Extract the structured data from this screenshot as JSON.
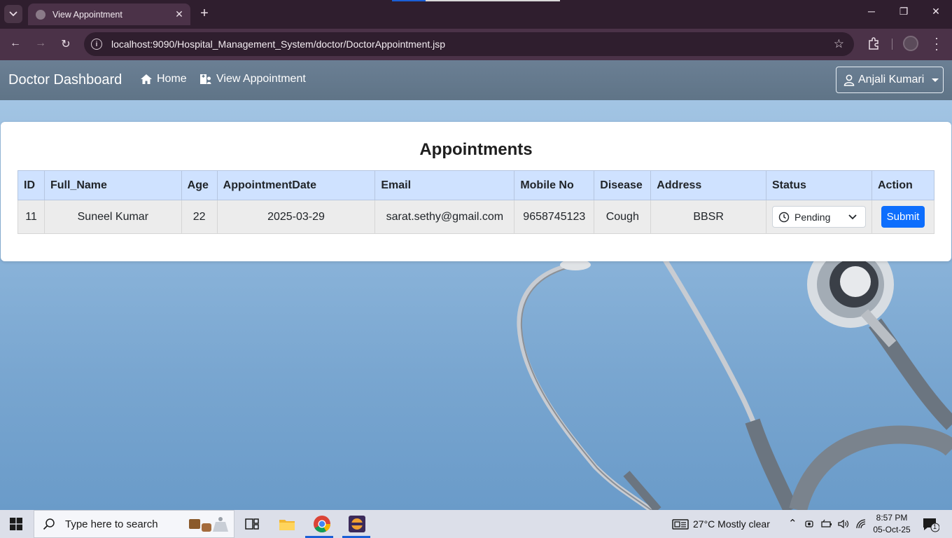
{
  "browser": {
    "tab_title": "View Appointment",
    "url": "localhost:9090/Hospital_Management_System/doctor/DoctorAppointment.jsp"
  },
  "navbar": {
    "brand": "Doctor Dashboard",
    "links": [
      {
        "label": "Home",
        "icon": "home-icon"
      },
      {
        "label": "View Appointment",
        "icon": "hospital-user-icon"
      }
    ],
    "user": {
      "label": "Anjali Kumari",
      "icon": "user-icon"
    }
  },
  "appointments": {
    "title": "Appointments",
    "columns": [
      "ID",
      "Full_Name",
      "Age",
      "AppointmentDate",
      "Email",
      "Mobile No",
      "Disease",
      "Address",
      "Status",
      "Action"
    ],
    "rows": [
      {
        "id": "11",
        "full_name": "Suneel Kumar",
        "age": "22",
        "appointment_date": "2025-03-29",
        "email": "sarat.sethy@gmail.com",
        "mobile": "9658745123",
        "disease": "Cough",
        "address": "BBSR",
        "status": "Pending",
        "action": "Submit"
      }
    ]
  },
  "taskbar": {
    "search_placeholder": "Type here to search",
    "weather": "27°C  Mostly clear",
    "time": "8:57 PM",
    "date": "05-Oct-25",
    "notification_count": "1"
  },
  "colors": {
    "navbar": "#5f7487",
    "table_header": "#cfe2ff",
    "submit": "#0d6efd",
    "browser_frame": "#4b3248"
  }
}
